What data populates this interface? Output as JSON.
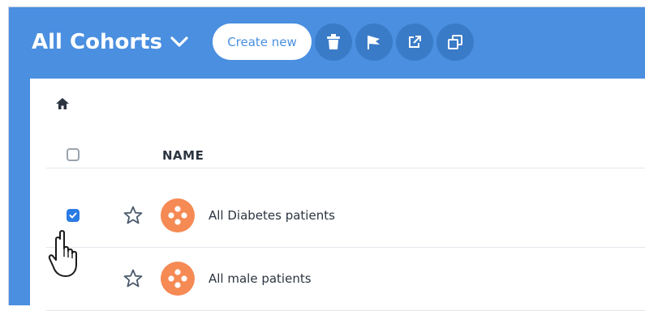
{
  "header": {
    "title": "All Cohorts",
    "create_label": "Create new",
    "tools": [
      "trash-icon",
      "flag-icon",
      "share-icon",
      "duplicate-icon"
    ]
  },
  "breadcrumb": {
    "icon": "home-icon"
  },
  "table": {
    "name_header": "NAME",
    "rows": [
      {
        "label": "All Diabetes patients",
        "checked": true,
        "starred": false
      },
      {
        "label": "All male patients",
        "checked": false,
        "starred": false
      }
    ]
  },
  "colors": {
    "header_bg": "#4a8fe0",
    "accent_orange": "#f58a54",
    "checkbox_blue": "#2a7be4"
  }
}
